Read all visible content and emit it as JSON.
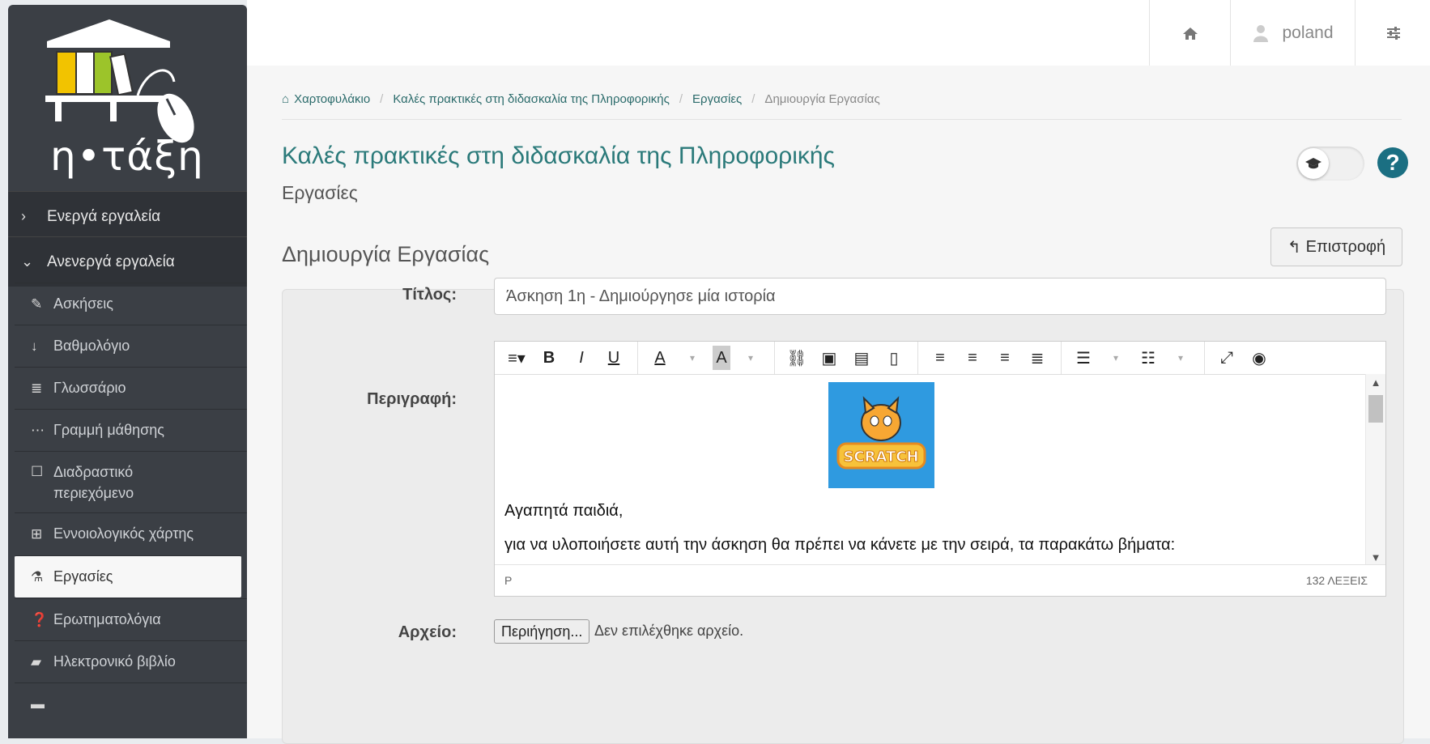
{
  "sidebar": {
    "logo_text": "η•τάξη",
    "sections": [
      {
        "label": "Ενεργά εργαλεία",
        "expanded": false
      },
      {
        "label": "Ανενεργά εργαλεία",
        "expanded": true
      }
    ],
    "items": [
      {
        "label": "Ασκήσεις",
        "icon": "edit-icon"
      },
      {
        "label": "Βαθμολόγιο",
        "icon": "sort-numeric-icon"
      },
      {
        "label": "Γλωσσάριο",
        "icon": "list-icon"
      },
      {
        "label": "Γραμμή μάθησης",
        "icon": "ellipsis-icon"
      },
      {
        "label": "Διαδραστικό περιεχόμενο",
        "icon": "square-icon"
      },
      {
        "label": "Εννοιολογικός χάρτης",
        "icon": "sitemap-icon"
      },
      {
        "label": "Εργασίες",
        "icon": "flask-icon",
        "active": true
      },
      {
        "label": "Ερωτηματολόγια",
        "icon": "question-circle-icon"
      },
      {
        "label": "Ηλεκτρονικό βιβλίο",
        "icon": "book-icon"
      }
    ]
  },
  "topbar": {
    "username": "poland"
  },
  "breadcrumb": [
    {
      "label": "Χαρτοφυλάκιο",
      "link": true
    },
    {
      "label": "Καλές πρακτικές στη διδασκαλία της Πληροφορικής",
      "link": true
    },
    {
      "label": "Εργασίες",
      "link": true
    },
    {
      "label": "Δημιουργία Εργασίας",
      "link": false
    }
  ],
  "course": {
    "title": "Καλές πρακτικές στη διδασκαλία της Πληροφορικής",
    "subtitle": "Εργασίες"
  },
  "page": {
    "heading": "Δημιουργία Εργασίας",
    "back_label": "Επιστροφή"
  },
  "form": {
    "title_label": "Τίτλος:",
    "title_value": "Άσκηση 1η - Δημιούργησε μία ιστορία",
    "description_label": "Περιγραφή:",
    "file_label": "Αρχείο:",
    "browse_label": "Περιήγηση...",
    "file_status": "Δεν επιλέχθηκε αρχείο."
  },
  "editor": {
    "image_text": "SCRATCH",
    "paragraph1": "Αγαπητά παιδιά,",
    "paragraph2": "για να υλοποιήσετε αυτή την άσκηση θα πρέπει να κάνετε με την σειρά, τα παρακάτω βήματα:",
    "path": "P",
    "word_count": "132 ΛΕΞΕΙΣ"
  },
  "colors": {
    "sidebar_bg": "#3b3f45",
    "accent": "#2b7a7a",
    "help": "#1b6f82",
    "scratch_bg": "#2f9ae0"
  }
}
